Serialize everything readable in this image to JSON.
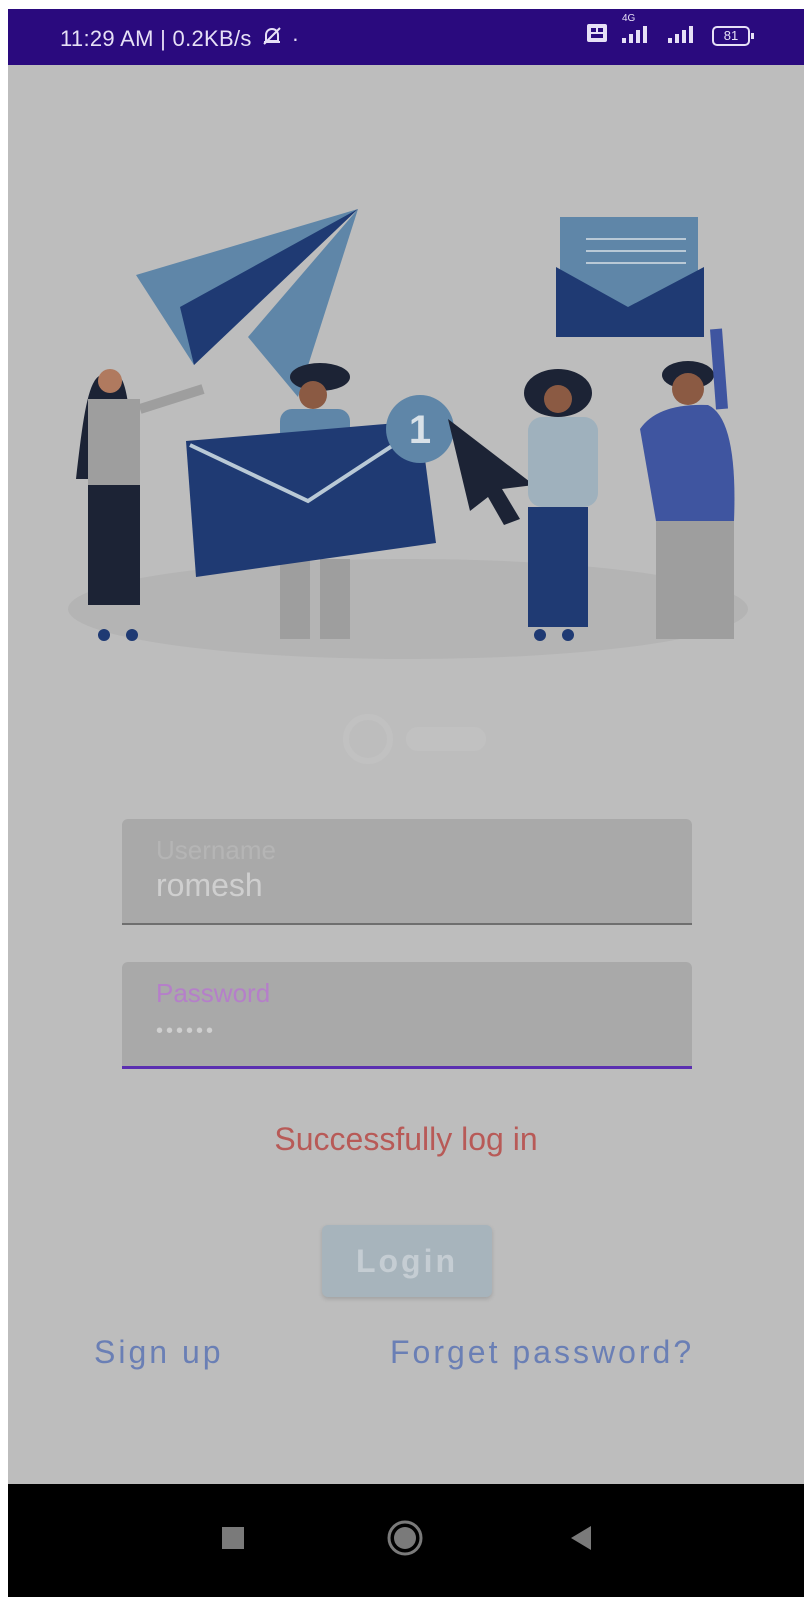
{
  "status_bar": {
    "time": "11:29 AM | 0.2KB/s",
    "network_badge": "4G",
    "battery": "81",
    "icons": [
      "mute-bell-icon",
      "sim-icon",
      "signal-icon",
      "battery-icon"
    ]
  },
  "form": {
    "username_label": "Username",
    "username_value": "romesh",
    "password_label": "Password",
    "password_value": "••••••"
  },
  "message": "Successfully log in",
  "login_button": "Login",
  "links": {
    "signup": "Sign up",
    "forget": "Forget password?"
  },
  "navigation": {
    "icons": [
      "recent-apps-icon",
      "home-icon",
      "back-icon"
    ]
  },
  "colors": {
    "status_bar": "#2a0a7e",
    "background": "#bdbdbd",
    "message": "#b85a57",
    "link": "#6a7fb5",
    "accent": "#5b2fb1"
  }
}
